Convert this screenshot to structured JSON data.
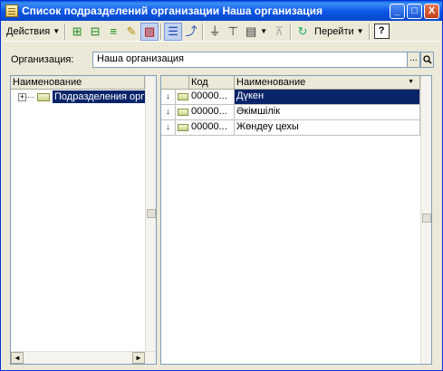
{
  "window": {
    "title": "Список подразделений организации Наша организация",
    "minimize_label": "_",
    "maximize_label": "□",
    "close_label": "X"
  },
  "toolbar": {
    "actions_label": "Действия",
    "goto_label": "Перейти",
    "help_label": "?",
    "icons": [
      "add-icon",
      "add-group-icon",
      "copy-icon",
      "edit-icon",
      "delete-mark-icon",
      "hierarchy-icon",
      "move-to-group-icon",
      "filter-icon",
      "filter-by-value-icon",
      "filter-list-icon",
      "disable-filter-icon",
      "refresh-icon"
    ]
  },
  "organization": {
    "label": "Организация:",
    "value": "Наша организация",
    "select_button": "...",
    "search_button": "🔍"
  },
  "tree": {
    "header": "Наименование",
    "items": [
      {
        "label": "Подразделения орг",
        "selected": true
      }
    ]
  },
  "table": {
    "columns": [
      "Код",
      "Наименование"
    ],
    "rows": [
      {
        "marker": "↓",
        "code": "00000...",
        "name": "Дүкен",
        "selected": true
      },
      {
        "marker": "↓",
        "code": "00000...",
        "name": "Әкімшілік",
        "selected": false
      },
      {
        "marker": "↓",
        "code": "00000...",
        "name": "Жөндеу цехы",
        "selected": false
      }
    ]
  },
  "colors": {
    "selection": "#0a246a",
    "title_bar": "#0b55e6",
    "window_bg": "#ece9d8"
  }
}
